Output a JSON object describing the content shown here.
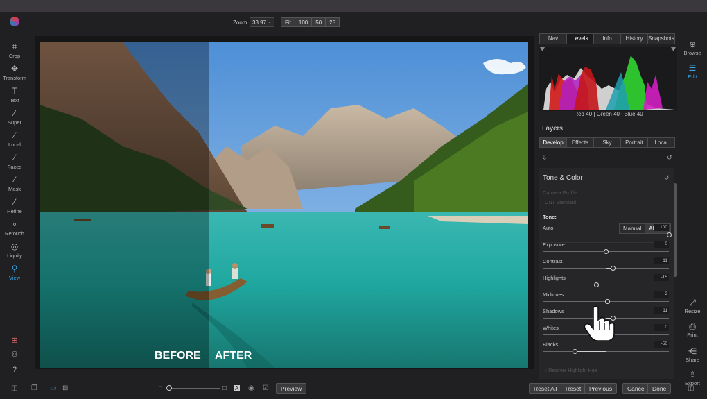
{
  "topbar": {
    "zoom_label": "Zoom",
    "zoom_value": "33.97",
    "zoom_presets": [
      "Fit",
      "100",
      "50",
      "25"
    ]
  },
  "left_tools": [
    {
      "label": "Crop",
      "icon": "crop-icon",
      "glyph": "⌗"
    },
    {
      "label": "Transform",
      "icon": "transform-icon",
      "glyph": "✥"
    },
    {
      "label": "Text",
      "icon": "text-icon",
      "glyph": "T"
    },
    {
      "label": "Super",
      "icon": "magic-wand-icon",
      "glyph": "⁄"
    },
    {
      "label": "Local",
      "icon": "brush-icon",
      "glyph": "⁄"
    },
    {
      "label": "Faces",
      "icon": "faces-brush-icon",
      "glyph": "⁄"
    },
    {
      "label": "Mask",
      "icon": "mask-icon",
      "glyph": "⁄"
    },
    {
      "label": "Refine",
      "icon": "refine-icon",
      "glyph": "⁄"
    },
    {
      "label": "Retouch",
      "icon": "retouch-icon",
      "glyph": "∘"
    },
    {
      "label": "Liquify",
      "icon": "liquify-icon",
      "glyph": "◎"
    },
    {
      "label": "View",
      "icon": "view-icon",
      "glyph": "⚲",
      "active": true
    }
  ],
  "photo": {
    "before_label": "BEFORE",
    "after_label": "AFTER"
  },
  "right_panel": {
    "nav_tabs": [
      "Nav",
      "Levels",
      "Info",
      "History",
      "Snapshots"
    ],
    "active_nav_tab": "Levels",
    "histogram_legend": "Red  40  | Green  40  | Blue  40",
    "layers_title": "Layers",
    "layer_tabs": [
      "Develop",
      "Effects",
      "Sky",
      "Portrait",
      "Local"
    ],
    "active_layer_tab": "Develop",
    "section_title": "Tone & Color",
    "camera_profile_label": "Camera Profile:",
    "camera_profile_value": "ONT Standard",
    "tone_label": "Tone:",
    "tone_modes": [
      "Manual",
      "AI Auto"
    ],
    "auto": {
      "name": "Auto",
      "value": "100",
      "level": 1.0
    },
    "sliders": [
      {
        "name": "Exposure",
        "value": "0",
        "level": 0.5
      },
      {
        "name": "Contrast",
        "value": "11",
        "level": 0.555
      },
      {
        "name": "Highlights",
        "value": "-15",
        "level": 0.425
      },
      {
        "name": "Midtones",
        "value": "2",
        "level": 0.51
      },
      {
        "name": "Shadows",
        "value": "11",
        "level": 0.555
      },
      {
        "name": "Whites",
        "value": "0",
        "level": 0.5
      },
      {
        "name": "Blacks",
        "value": "-50",
        "level": 0.25
      }
    ],
    "recover_label": "Recover Highlight Hue"
  },
  "right_tools": [
    {
      "label": "Browse",
      "icon": "browse-icon",
      "glyph": "⊕"
    },
    {
      "label": "Edit",
      "icon": "edit-sliders-icon",
      "glyph": "☰",
      "active": true
    },
    {
      "label": "Resize",
      "icon": "resize-icon",
      "glyph": "⤢"
    },
    {
      "label": "Print",
      "icon": "print-icon",
      "glyph": "⎙"
    },
    {
      "label": "Share",
      "icon": "share-icon",
      "glyph": "⋲"
    },
    {
      "label": "Export",
      "icon": "export-icon",
      "glyph": "⇪"
    }
  ],
  "bottombar": {
    "preview_label": "Preview",
    "reset_all_label": "Reset All",
    "reset_label": "Reset",
    "previous_label": "Previous",
    "cancel_label": "Cancel",
    "done_label": "Done"
  },
  "colors": {
    "accent": "#3aa6e8",
    "background": "#202022",
    "histogram_red": "#d01a1a",
    "histogram_green": "#2fc22f",
    "histogram_blue": "#2a4fd8"
  }
}
